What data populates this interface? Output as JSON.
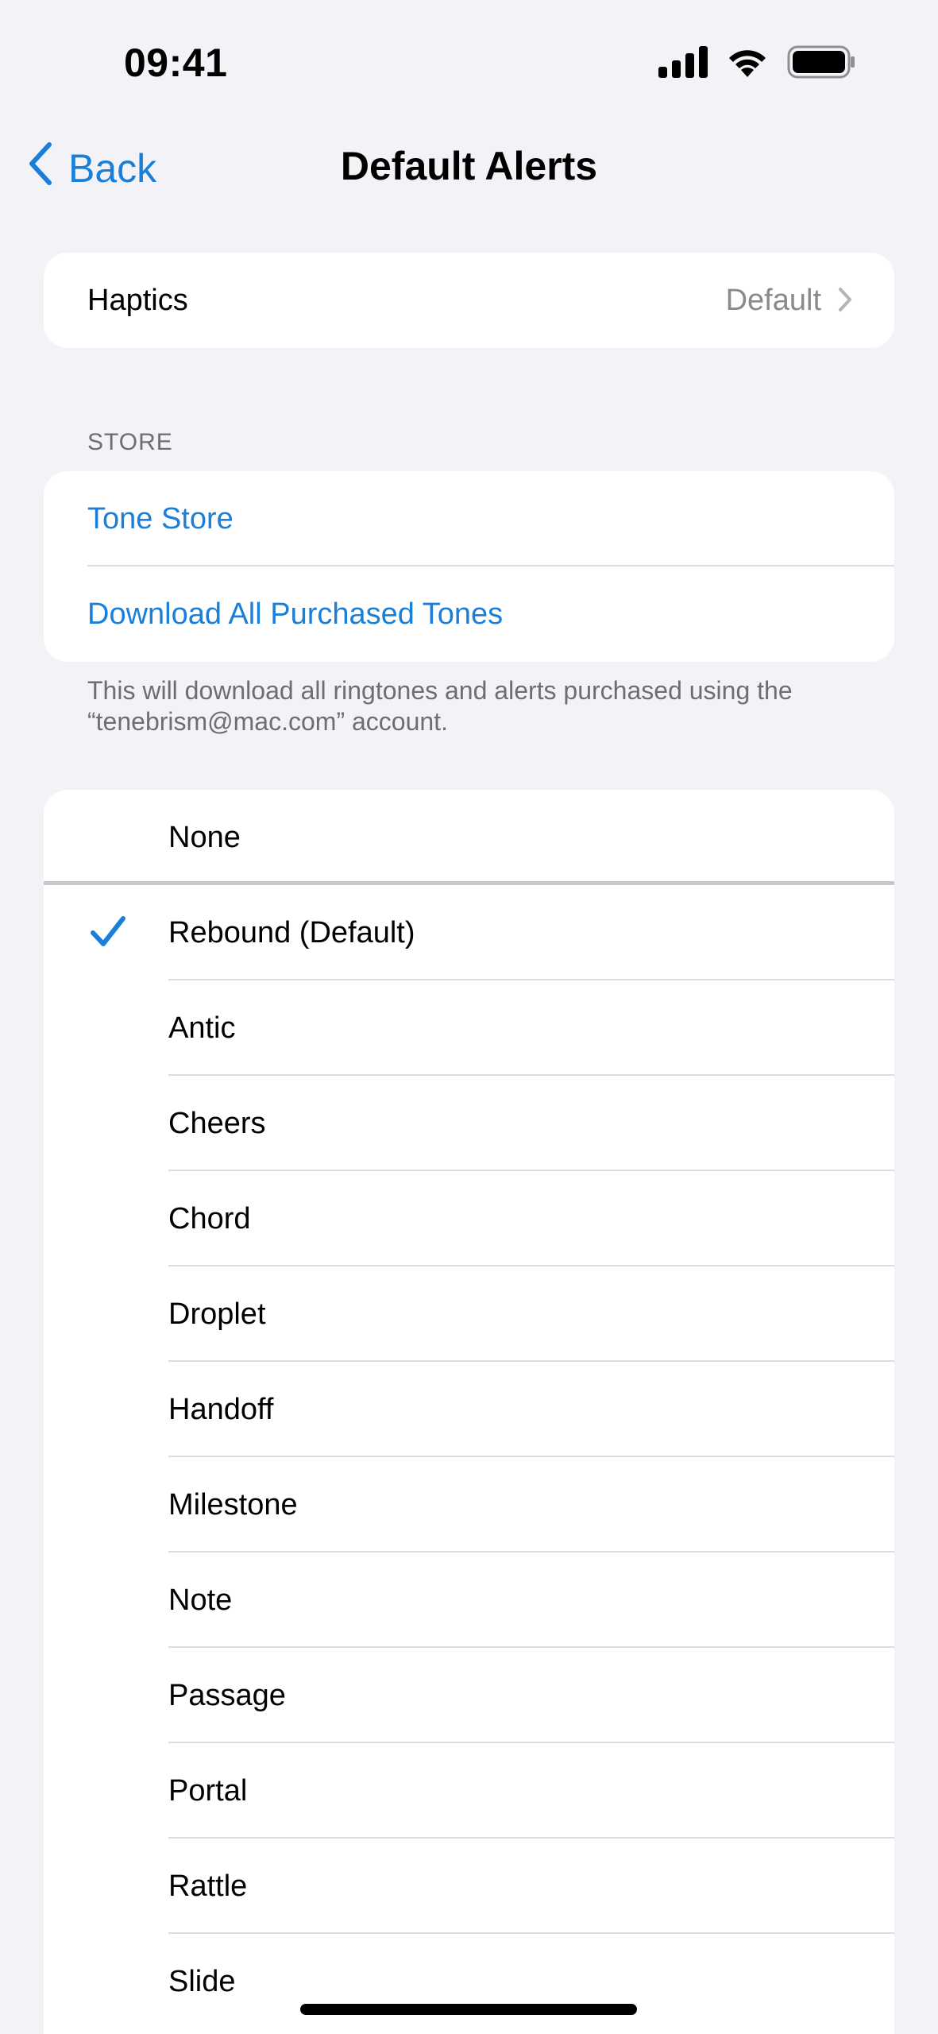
{
  "status_bar": {
    "time": "09:41"
  },
  "nav": {
    "back_label": "Back",
    "title": "Default Alerts"
  },
  "haptics": {
    "label": "Haptics",
    "value": "Default"
  },
  "store": {
    "header": "STORE",
    "tone_store_label": "Tone Store",
    "download_label": "Download All Purchased Tones",
    "footer": "This will download all ringtones and alerts purchased using the “tenebrism@mac.com” account."
  },
  "tones": {
    "none_label": "None",
    "selected_index": 0,
    "items": [
      "Rebound (Default)",
      "Antic",
      "Cheers",
      "Chord",
      "Droplet",
      "Handoff",
      "Milestone",
      "Note",
      "Passage",
      "Portal",
      "Rattle",
      "Slide"
    ]
  },
  "colors": {
    "accent": "#1a7fd9",
    "background": "#f2f2f7",
    "secondary_text": "#8a8a8e"
  }
}
